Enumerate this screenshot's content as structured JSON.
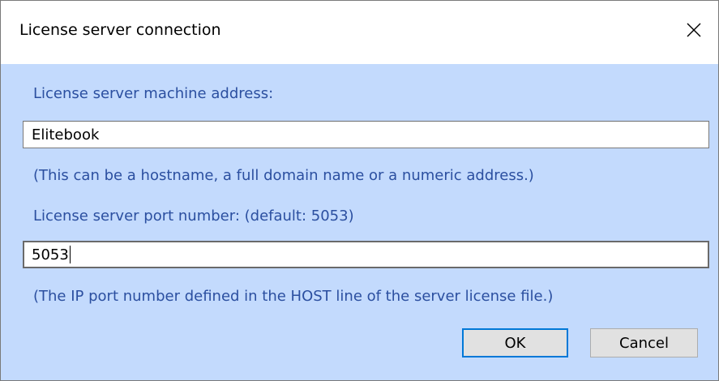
{
  "window": {
    "title": "License server connection"
  },
  "address": {
    "label": "License server machine address:",
    "value": "Elitebook",
    "hint": "(This can be a hostname, a full domain name or a numeric address.)"
  },
  "port": {
    "label": "License server port number: (default: 5053)",
    "value": "5053",
    "hint": "(The IP port number defined in the HOST line of the server license file.)"
  },
  "buttons": {
    "ok": "OK",
    "cancel": "Cancel"
  },
  "icons": {
    "close": "close-icon"
  },
  "colors": {
    "content_background": "#c3dafd",
    "label_text": "#2b4fa0",
    "default_button_border": "#0078d7"
  }
}
